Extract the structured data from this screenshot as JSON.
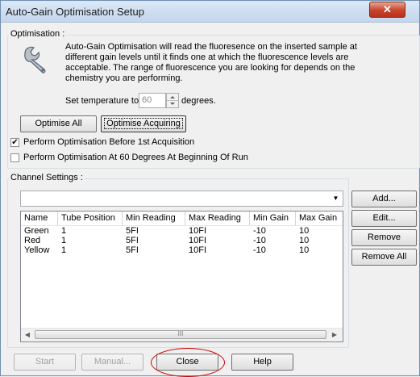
{
  "window": {
    "title": "Auto-Gain Optimisation Setup",
    "close_glyph": "✕"
  },
  "optimisation": {
    "legend": "Optimisation :",
    "icon": "wrench-icon",
    "description_lines": [
      "Auto-Gain Optimisation will read the fluoresence on the inserted sample at",
      "different gain levels until it finds one at which the fluorescence levels are",
      "acceptable. The range of fluorescence you are looking for depends on the",
      "chemistry you are performing."
    ],
    "temperature_prefix": "Set temperature to",
    "temperature_value": "60",
    "temperature_suffix": "degrees.",
    "optimise_all_label": "Optimise All",
    "optimise_acquiring_label": "Optimise Acquiring",
    "checkbox_before_label": "Perform Optimisation Before 1st Acquisition",
    "checkbox_before_checked": true,
    "checkbox_before_glyph": "✔",
    "checkbox_at60_label": "Perform Optimisation At 60 Degrees At Beginning Of Run",
    "checkbox_at60_checked": false
  },
  "channel_settings": {
    "legend": "Channel Settings :",
    "combo_value": "",
    "combo_arrow": "▼",
    "columns": [
      "Name",
      "Tube Position",
      "Min Reading",
      "Max Reading",
      "Min Gain",
      "Max Gain"
    ],
    "rows": [
      [
        "Green",
        "1",
        "5FI",
        "10FI",
        "-10",
        "10"
      ],
      [
        "Red",
        "1",
        "5FI",
        "10FI",
        "-10",
        "10"
      ],
      [
        "Yellow",
        "1",
        "5FI",
        "10FI",
        "-10",
        "10"
      ]
    ],
    "scroll_left": "◀",
    "scroll_right": "▶",
    "scroll_thumb_grip": "III",
    "buttons": {
      "add": "Add...",
      "edit": "Edit...",
      "remove": "Remove",
      "remove_all": "Remove All"
    }
  },
  "footer": {
    "start": "Start",
    "manual": "Manual...",
    "close": "Close",
    "help": "Help",
    "annotation_color": "#cc0000"
  }
}
